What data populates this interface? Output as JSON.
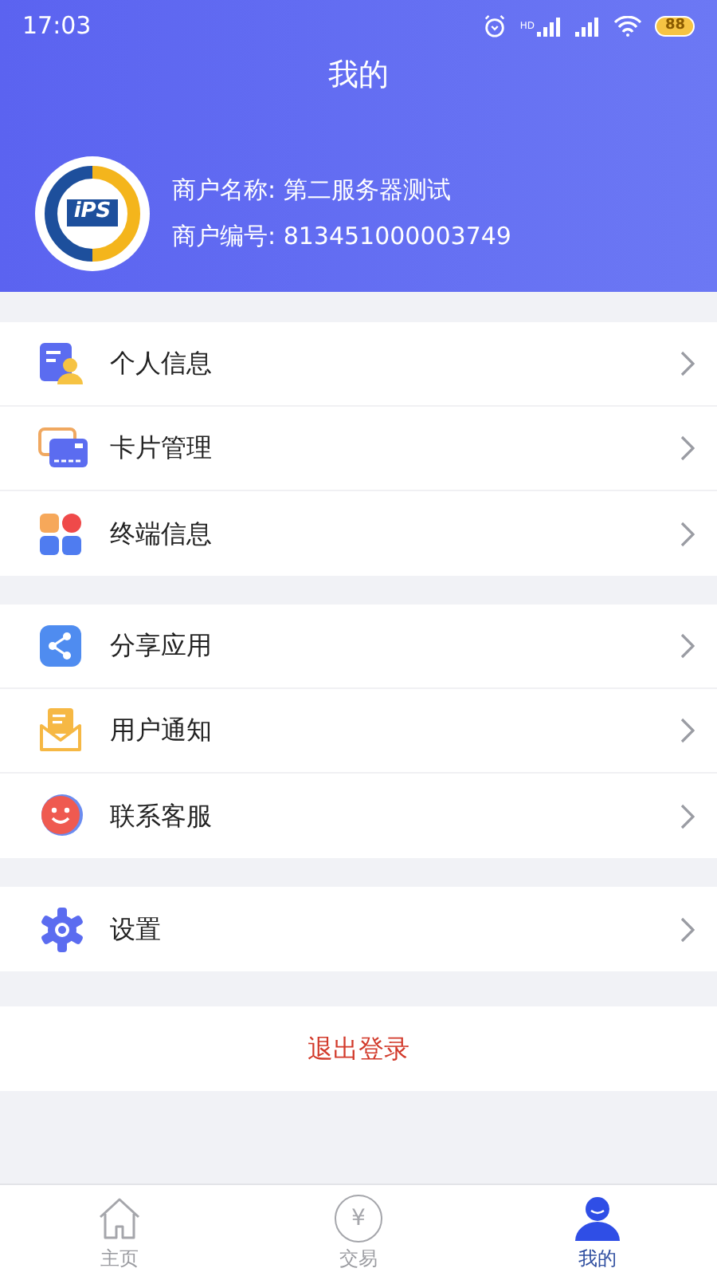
{
  "status_bar": {
    "time": "17:03",
    "network_label": "HD",
    "battery": "88"
  },
  "header": {
    "title": "我的"
  },
  "merchant": {
    "name_line": "商户名称: 第二服务器测试",
    "number_line": "商户编号: 813451000003749",
    "logo_text": "iPS"
  },
  "menu_groups": [
    {
      "items": [
        {
          "kind": "profile",
          "label": "个人信息"
        },
        {
          "kind": "card",
          "label": "卡片管理"
        },
        {
          "kind": "terminal",
          "label": "终端信息"
        }
      ]
    },
    {
      "items": [
        {
          "kind": "share",
          "label": "分享应用"
        },
        {
          "kind": "notice",
          "label": "用户通知"
        },
        {
          "kind": "service",
          "label": "联系客服"
        }
      ]
    },
    {
      "items": [
        {
          "kind": "settings",
          "label": "设置"
        }
      ]
    }
  ],
  "logout": {
    "label": "退出登录"
  },
  "tab_bar": [
    {
      "kind": "home",
      "label": "主页",
      "selected": false
    },
    {
      "kind": "trade",
      "label": "交易",
      "glyph": "¥",
      "selected": false
    },
    {
      "kind": "me",
      "label": "我的",
      "selected": true
    }
  ]
}
